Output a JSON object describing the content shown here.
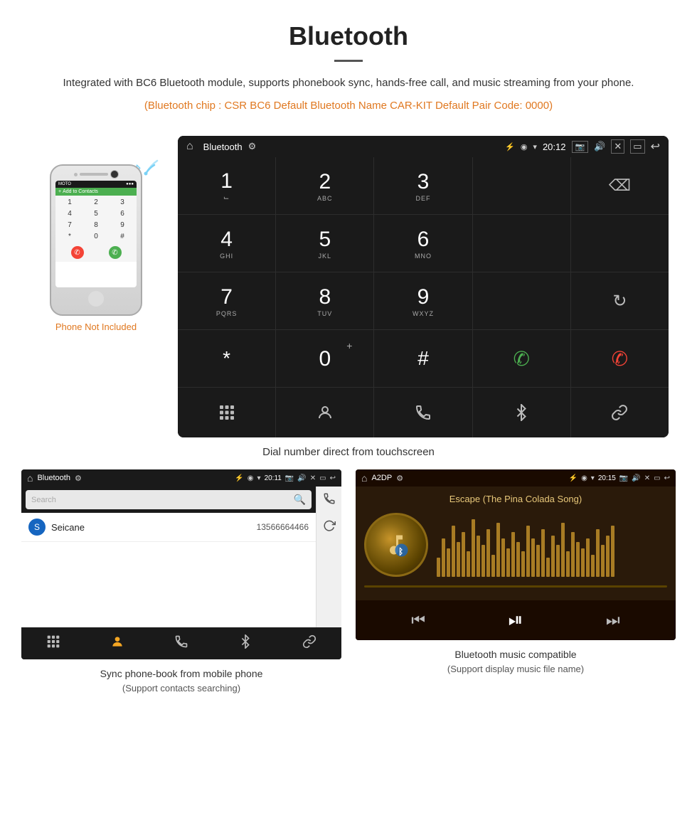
{
  "page": {
    "title": "Bluetooth",
    "description": "Integrated with BC6 Bluetooth module, supports phonebook sync, hands-free call, and music streaming from your phone.",
    "specs": "(Bluetooth chip : CSR BC6    Default Bluetooth Name CAR-KIT    Default Pair Code: 0000)",
    "phone_not_included": "Phone Not Included",
    "dial_caption": "Dial number direct from touchscreen",
    "contacts_caption": "Sync phone-book from mobile phone",
    "contacts_subcaption": "(Support contacts searching)",
    "music_caption": "Bluetooth music compatible",
    "music_subcaption": "(Support display music file name)"
  },
  "dialer": {
    "status_title": "Bluetooth",
    "time": "20:12",
    "keys": [
      {
        "num": "1",
        "sub": ""
      },
      {
        "num": "2",
        "sub": "ABC"
      },
      {
        "num": "3",
        "sub": "DEF"
      },
      {
        "num": "4",
        "sub": "GHI"
      },
      {
        "num": "5",
        "sub": "JKL"
      },
      {
        "num": "6",
        "sub": "MNO"
      },
      {
        "num": "7",
        "sub": "PQRS"
      },
      {
        "num": "8",
        "sub": "TUV"
      },
      {
        "num": "9",
        "sub": "WXYZ"
      },
      {
        "num": "*",
        "sub": ""
      },
      {
        "num": "0",
        "sub": "+"
      },
      {
        "num": "#",
        "sub": ""
      }
    ]
  },
  "contacts": {
    "status_title": "Bluetooth",
    "time": "20:11",
    "search_placeholder": "Search",
    "contact_name": "Seicane",
    "contact_phone": "13566664466",
    "contact_letter": "S"
  },
  "music": {
    "status_title": "A2DP",
    "time": "20:15",
    "song_title": "Escape (The Pina Colada Song)"
  },
  "icons": {
    "home": "⌂",
    "bluetooth": "⚡",
    "usb": "⚿",
    "wifi": "▾",
    "signal": "▾",
    "camera": "📷",
    "volume": "🔊",
    "close_x": "✕",
    "screen": "▭",
    "back": "↩",
    "backspace": "⌫",
    "call_green": "📞",
    "call_red": "📵",
    "refresh": "↻",
    "contacts": "👤",
    "keypad": "⊞",
    "bt_music": "❋",
    "link": "🔗",
    "prev": "⏮",
    "play_pause": "⏯",
    "next": "⏭"
  }
}
